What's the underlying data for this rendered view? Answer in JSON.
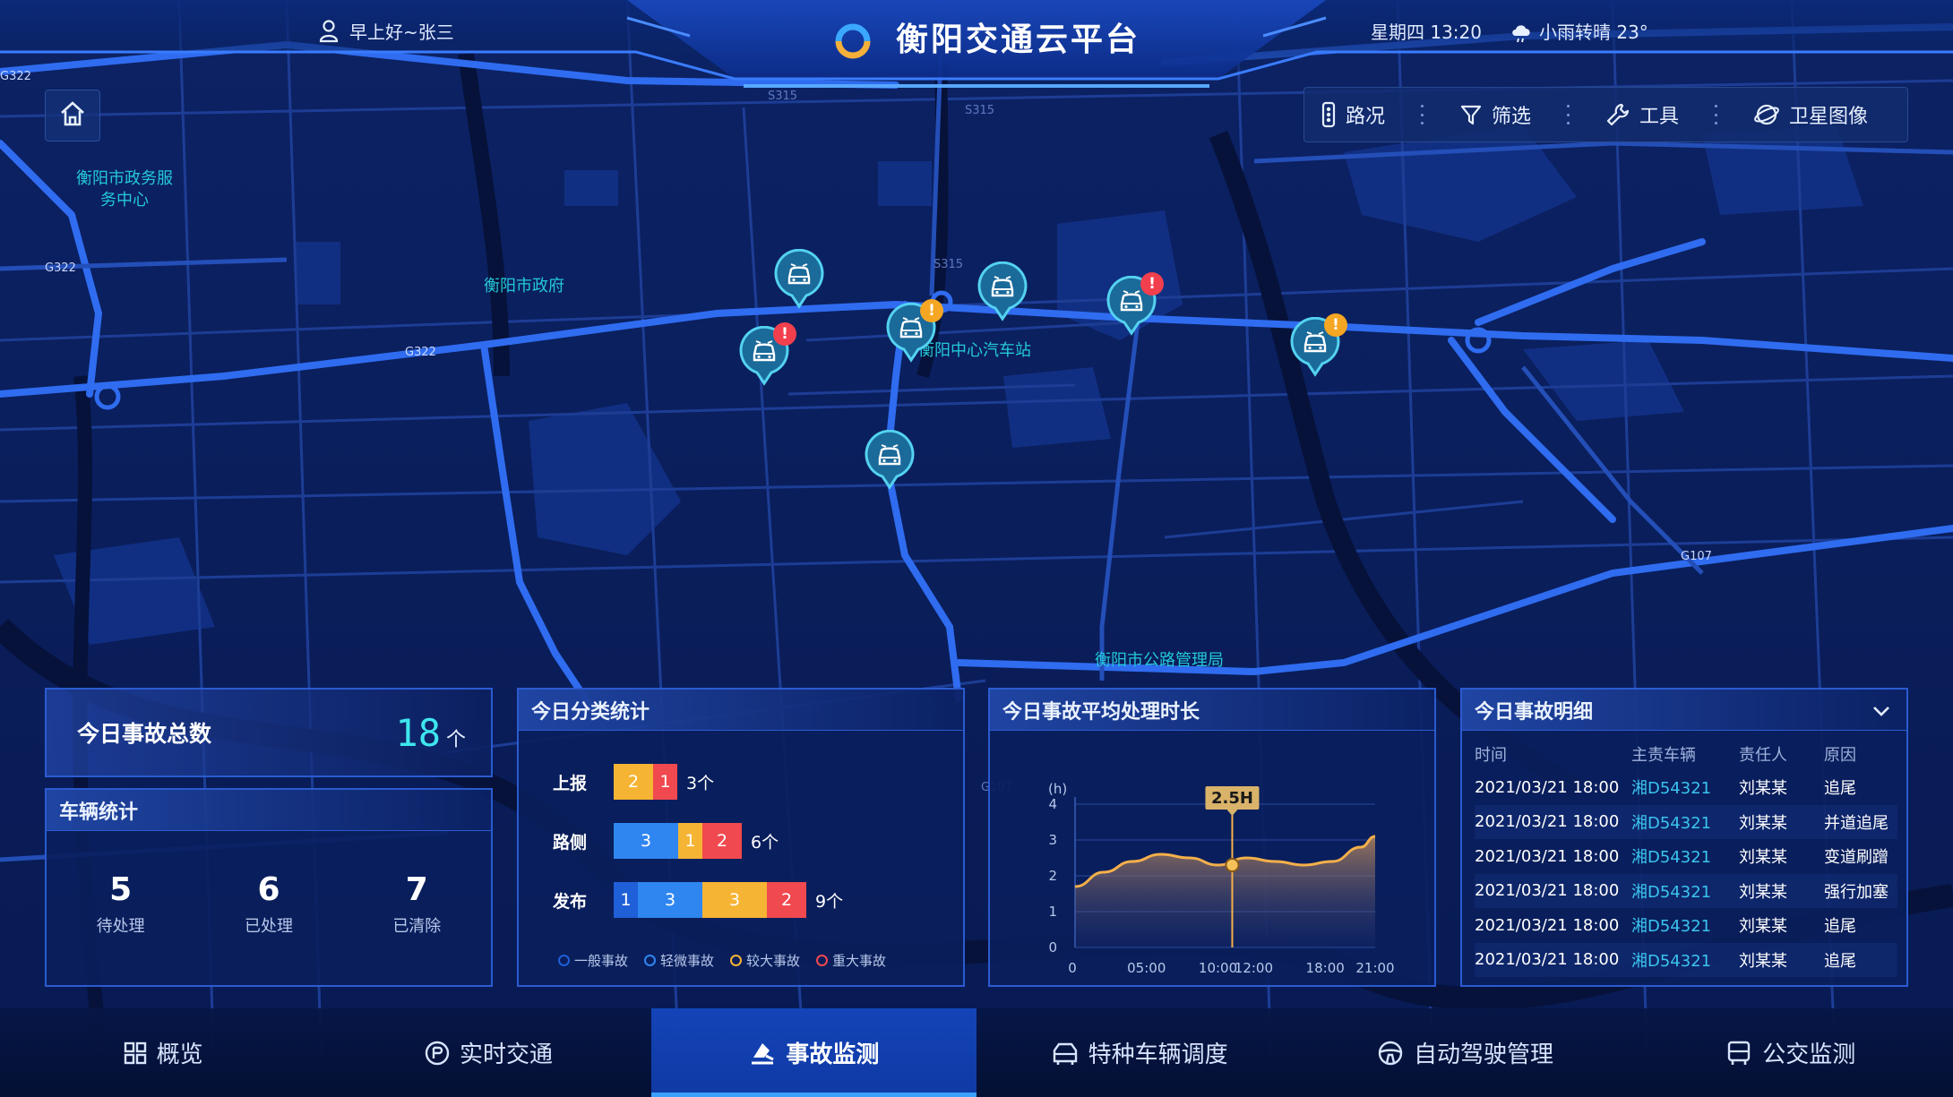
{
  "header": {
    "greeting": "早上好~张三",
    "title": "衡阳交通云平台",
    "datetime": "星期四 13:20",
    "weather": "小雨转晴 23°"
  },
  "toolbar": {
    "items": [
      {
        "label": "路况",
        "icon": "traffic-light-icon"
      },
      {
        "label": "筛选",
        "icon": "filter-icon"
      },
      {
        "label": "工具",
        "icon": "wrench-icon"
      },
      {
        "label": "卫星图像",
        "icon": "satellite-icon"
      }
    ]
  },
  "map": {
    "labels": [
      "衡阳市政务服务中心",
      "衡阳市政府",
      "衡阳中心汽车站",
      "衡阳市公路管理局"
    ],
    "road_labels": [
      "G322",
      "G322",
      "G322",
      "S315",
      "S315",
      "S315",
      "G107",
      "G107"
    ]
  },
  "accident_total": {
    "label": "今日事故总数",
    "value": "18",
    "unit": "个"
  },
  "vehicle_stats": {
    "title": "车辆统计",
    "items": [
      {
        "value": "5",
        "label": "待处理"
      },
      {
        "value": "6",
        "label": "已处理"
      },
      {
        "value": "7",
        "label": "已清除"
      }
    ]
  },
  "classification": {
    "title": "今日分类统计",
    "rows": [
      {
        "label": "上报",
        "segments": [
          {
            "type": "较大事故",
            "value": 2
          },
          {
            "type": "重大事故",
            "value": 1
          }
        ],
        "total": "3个"
      },
      {
        "label": "路侧",
        "segments": [
          {
            "type": "轻微事故",
            "value": 3
          },
          {
            "type": "较大事故",
            "value": 1
          },
          {
            "type": "重大事故",
            "value": 2
          }
        ],
        "total": "6个"
      },
      {
        "label": "发布",
        "segments": [
          {
            "type": "一般事故",
            "value": 1
          },
          {
            "type": "轻微事故",
            "value": 3
          },
          {
            "type": "较大事故",
            "value": 3
          },
          {
            "type": "重大事故",
            "value": 2
          }
        ],
        "total": "9个"
      }
    ],
    "legend": [
      {
        "label": "一般事故",
        "color": "#1f5fd8"
      },
      {
        "label": "轻微事故",
        "color": "#2f86f0"
      },
      {
        "label": "较大事故",
        "color": "#f6b434"
      },
      {
        "label": "重大事故",
        "color": "#f0494f"
      }
    ]
  },
  "avg_time": {
    "title": "今日事故平均处理时长",
    "highlight_label": "2.5H"
  },
  "chart_data": {
    "type": "area",
    "title": "今日事故平均处理时长",
    "ylabel": "(h)",
    "y_ticks": [
      "0",
      "1",
      "2",
      "3",
      "4"
    ],
    "x_ticks": [
      "0",
      "05:00",
      "10:00",
      "12:00",
      "18:00",
      "21:00"
    ],
    "ylim": [
      0,
      4
    ],
    "x": [
      0,
      2,
      4,
      6,
      8,
      10,
      12,
      14,
      16,
      18,
      20,
      21
    ],
    "values": [
      1.7,
      2.1,
      2.4,
      2.6,
      2.5,
      2.3,
      2.5,
      2.4,
      2.3,
      2.4,
      2.8,
      3.1
    ],
    "highlight": {
      "x": 11,
      "y": 2.3,
      "label": "2.5H"
    },
    "grid": true,
    "line_color": "#f5b04a"
  },
  "details": {
    "title": "今日事故明细",
    "columns": [
      "时间",
      "主责车辆",
      "责任人",
      "原因"
    ],
    "rows": [
      [
        "2021/03/21 18:00",
        "湘D54321",
        "刘某某",
        "追尾"
      ],
      [
        "2021/03/21 18:00",
        "湘D54321",
        "刘某某",
        "并道追尾"
      ],
      [
        "2021/03/21 18:00",
        "湘D54321",
        "刘某某",
        "变道刷蹭"
      ],
      [
        "2021/03/21 18:00",
        "湘D54321",
        "刘某某",
        "强行加塞"
      ],
      [
        "2021/03/21 18:00",
        "湘D54321",
        "刘某某",
        "追尾"
      ],
      [
        "2021/03/21 18:00",
        "湘D54321",
        "刘某某",
        "追尾"
      ]
    ]
  },
  "bottom_nav": {
    "items": [
      {
        "label": "概览",
        "icon": "grid-icon"
      },
      {
        "label": "实时交通",
        "icon": "traffic-icon"
      },
      {
        "label": "事故监测",
        "icon": "accident-icon",
        "active": true
      },
      {
        "label": "特种车辆调度",
        "icon": "vehicle-icon"
      },
      {
        "label": "自动驾驶管理",
        "icon": "steering-wheel-icon"
      },
      {
        "label": "公交监测",
        "icon": "bus-icon"
      }
    ]
  }
}
